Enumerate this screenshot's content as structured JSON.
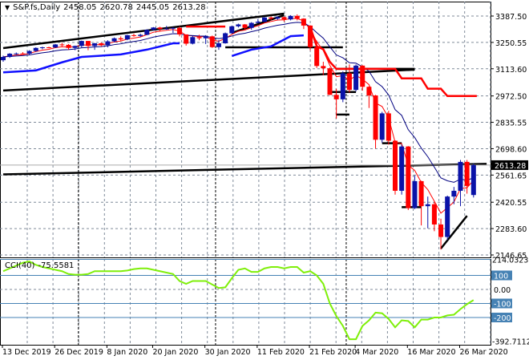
{
  "header": {
    "symbol": "S&P.fs,Daily",
    "open": "2458.05",
    "high": "2620.78",
    "low": "2445.05",
    "close": "2613.28"
  },
  "cci_header": {
    "name": "CCI(40)",
    "value": "-75.5581"
  },
  "colors": {
    "bull": "#0a12a8",
    "bear": "#ff0000",
    "cci": "#7fef0a",
    "cci_levels": "#4682b4",
    "grid": "#7f8a99"
  },
  "chart_data": [
    {
      "type": "candlestick",
      "title": "S&P.fs,Daily",
      "price_axis_labels": [
        "3387.50",
        "3250.55",
        "3113.60",
        "2972.50",
        "2835.55",
        "2698.60",
        "2561.65",
        "2420.55",
        "2283.60",
        "2146.65"
      ],
      "ylim": [
        2146.65,
        3387.5
      ],
      "current_price": "2613.28",
      "x_labels": [
        {
          "i": 0,
          "label": "13 Dec 2019"
        },
        {
          "i": 8,
          "label": "26 Dec 2019"
        },
        {
          "i": 16,
          "label": "8 Jan 2020"
        },
        {
          "i": 23,
          "label": "20 Jan 2020"
        },
        {
          "i": 31,
          "label": "30 Jan 2020"
        },
        {
          "i": 39,
          "label": "11 Feb 2020"
        },
        {
          "i": 47,
          "label": "21 Feb 2020"
        },
        {
          "i": 54,
          "label": "4 Mar 2020"
        },
        {
          "i": 62,
          "label": "16 Mar 2020"
        },
        {
          "i": 70,
          "label": "26 Mar 2020"
        }
      ],
      "month_separators": [
        12,
        33,
        53
      ],
      "ohlc": [
        [
          3158,
          3182,
          3150,
          3175
        ],
        [
          3175,
          3195,
          3170,
          3192
        ],
        [
          3192,
          3198,
          3185,
          3193
        ],
        [
          3193,
          3200,
          3188,
          3192
        ],
        [
          3192,
          3210,
          3188,
          3206
        ],
        [
          3206,
          3225,
          3202,
          3222
        ],
        [
          3222,
          3228,
          3215,
          3225
        ],
        [
          3225,
          3228,
          3220,
          3224
        ],
        [
          3224,
          3242,
          3222,
          3240
        ],
        [
          3240,
          3248,
          3230,
          3238
        ],
        [
          3238,
          3242,
          3212,
          3222
        ],
        [
          3222,
          3234,
          3210,
          3232
        ],
        [
          3232,
          3260,
          3225,
          3258
        ],
        [
          3258,
          3258,
          3210,
          3232
        ],
        [
          3232,
          3248,
          3212,
          3246
        ],
        [
          3246,
          3250,
          3230,
          3236
        ],
        [
          3236,
          3262,
          3225,
          3256
        ],
        [
          3256,
          3276,
          3250,
          3272
        ],
        [
          3272,
          3282,
          3258,
          3266
        ],
        [
          3266,
          3290,
          3262,
          3288
        ],
        [
          3288,
          3296,
          3280,
          3284
        ],
        [
          3284,
          3296,
          3278,
          3290
        ],
        [
          3290,
          3318,
          3288,
          3316
        ],
        [
          3316,
          3330,
          3312,
          3328
        ],
        [
          3328,
          3332,
          3310,
          3320
        ],
        [
          3320,
          3336,
          3316,
          3322
        ],
        [
          3322,
          3330,
          3300,
          3326
        ],
        [
          3326,
          3334,
          3282,
          3292
        ],
        [
          3292,
          3292,
          3234,
          3244
        ],
        [
          3244,
          3285,
          3240,
          3278
        ],
        [
          3278,
          3290,
          3262,
          3272
        ],
        [
          3272,
          3288,
          3242,
          3282
        ],
        [
          3282,
          3286,
          3222,
          3226
        ],
        [
          3226,
          3262,
          3212,
          3246
        ],
        [
          3246,
          3302,
          3244,
          3298
        ],
        [
          3298,
          3338,
          3296,
          3334
        ],
        [
          3334,
          3348,
          3328,
          3344
        ],
        [
          3344,
          3346,
          3318,
          3326
        ],
        [
          3326,
          3356,
          3316,
          3352
        ],
        [
          3352,
          3372,
          3350,
          3358
        ],
        [
          3358,
          3382,
          3356,
          3380
        ],
        [
          3380,
          3385,
          3365,
          3374
        ],
        [
          3374,
          3386,
          3368,
          3382
        ],
        [
          3382,
          3384,
          3358,
          3370
        ],
        [
          3370,
          3392,
          3365,
          3388
        ],
        [
          3388,
          3396,
          3365,
          3374
        ],
        [
          3374,
          3376,
          3320,
          3338
        ],
        [
          3338,
          3340,
          3210,
          3226
        ],
        [
          3226,
          3260,
          3118,
          3128
        ],
        [
          3128,
          3150,
          3080,
          3116
        ],
        [
          3116,
          3120,
          2978,
          2978
        ],
        [
          2978,
          3010,
          2855,
          2955
        ],
        [
          2955,
          3100,
          2940,
          3090
        ],
        [
          3090,
          3136,
          2990,
          3004
        ],
        [
          3004,
          3136,
          2996,
          3130
        ],
        [
          3130,
          3132,
          3000,
          3020
        ],
        [
          3020,
          3022,
          2910,
          2975
        ],
        [
          2975,
          2978,
          2700,
          2745
        ],
        [
          2745,
          2890,
          2730,
          2882
        ],
        [
          2882,
          2895,
          2720,
          2740
        ],
        [
          2740,
          2742,
          2460,
          2480
        ],
        [
          2480,
          2720,
          2460,
          2710
        ],
        [
          2710,
          2712,
          2380,
          2390
        ],
        [
          2390,
          2560,
          2385,
          2530
        ],
        [
          2530,
          2532,
          2300,
          2400
        ],
        [
          2400,
          2450,
          2285,
          2410
        ],
        [
          2410,
          2420,
          2270,
          2305
        ],
        [
          2305,
          2335,
          2175,
          2240
        ],
        [
          2240,
          2455,
          2225,
          2450
        ],
        [
          2450,
          2500,
          2410,
          2480
        ],
        [
          2480,
          2640,
          2400,
          2630
        ],
        [
          2630,
          2640,
          2465,
          2505
        ],
        [
          2458.05,
          2620.78,
          2445.05,
          2613.28
        ]
      ],
      "lower_band": [
        [
          0,
          3095
        ],
        [
          5,
          3105
        ],
        [
          9,
          3147
        ],
        [
          12,
          3175
        ],
        [
          18,
          3188
        ],
        [
          22,
          3213
        ],
        [
          26,
          3246
        ],
        [
          27,
          3246
        ]
      ],
      "lower_band_2": [
        [
          35,
          3180
        ],
        [
          38,
          3213
        ],
        [
          41,
          3230
        ],
        [
          44,
          3283
        ],
        [
          46,
          3287
        ]
      ],
      "red_step_line": [
        [
          28,
          3333
        ],
        [
          34,
          3333
        ],
        null,
        [
          47,
          3330
        ],
        [
          48,
          3230
        ],
        [
          49,
          3215
        ],
        [
          50,
          3150
        ],
        [
          51,
          3113
        ],
        [
          60,
          3113
        ],
        [
          61,
          3064
        ],
        [
          64,
          3064
        ],
        [
          65,
          3010
        ],
        [
          67,
          3010
        ],
        [
          68,
          2972
        ],
        [
          72.5,
          2972
        ]
      ],
      "trend_lines": [
        [
          [
            0,
            3221
          ],
          [
            43,
            3400
          ]
        ],
        [
          [
            35,
            3300
          ],
          [
            43,
            3392
          ]
        ],
        [
          [
            0,
            3001
          ],
          [
            63,
            3109
          ]
        ],
        [
          [
            0,
            2565
          ],
          [
            74,
            2620
          ]
        ],
        [
          [
            34,
            3225
          ],
          [
            52,
            3225
          ]
        ],
        [
          [
            51,
            3113
          ],
          [
            63,
            3113
          ]
        ],
        [
          [
            50,
            2993
          ],
          [
            54,
            2993
          ]
        ],
        [
          [
            51,
            2876
          ],
          [
            53,
            2876
          ]
        ],
        [
          [
            58,
            2727
          ],
          [
            61,
            2727
          ]
        ],
        [
          [
            61,
            2395
          ],
          [
            64,
            2395
          ]
        ],
        [
          [
            67,
            2180
          ],
          [
            71,
            2350
          ]
        ]
      ]
    },
    {
      "type": "line",
      "title": "CCI(40)",
      "levels": [
        100,
        -100,
        -200
      ],
      "level_labels": [
        "100",
        "-100",
        "-200"
      ],
      "zero_label": "0.00",
      "max_label": "214.0323",
      "min_label": "-392.7112",
      "ylim": [
        -392.7112,
        214.0323
      ],
      "values": [
        130,
        150,
        170,
        190,
        200,
        175,
        160,
        150,
        140,
        130,
        110,
        105,
        105,
        110,
        130,
        130,
        130,
        130,
        130,
        135,
        145,
        150,
        150,
        140,
        130,
        120,
        110,
        60,
        40,
        60,
        60,
        60,
        35,
        10,
        15,
        80,
        140,
        150,
        125,
        125,
        150,
        160,
        160,
        150,
        160,
        160,
        120,
        130,
        100,
        40,
        -100,
        -190,
        -260,
        -355,
        -355,
        -260,
        -220,
        -165,
        -170,
        -210,
        -270,
        -220,
        -225,
        -270,
        -215,
        -215,
        -200,
        -200,
        -185,
        -180,
        -140,
        -105,
        -75.5581
      ]
    }
  ]
}
